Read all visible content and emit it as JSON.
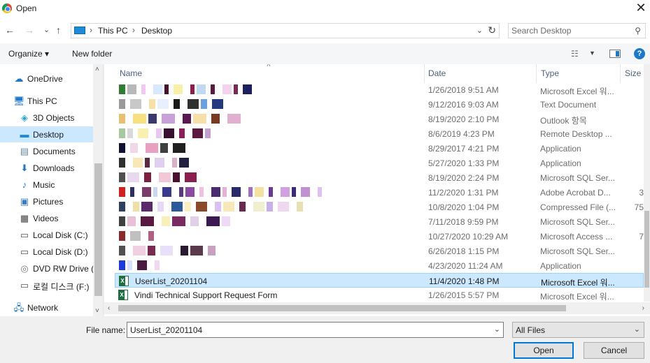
{
  "window": {
    "title": "Open",
    "close_glyph": "✕"
  },
  "nav": {
    "back": "←",
    "forward": "→",
    "recent": "⌄",
    "up": "↑"
  },
  "address": {
    "segments": [
      "This PC",
      "Desktop"
    ],
    "sep": "›",
    "dropdown": "⌄",
    "refresh": "↻"
  },
  "search": {
    "placeholder": "Search Desktop",
    "icon": "⚲"
  },
  "toolbar": {
    "organize": "Organize ▾",
    "new_folder": "New folder",
    "view_icon": "☷",
    "view_dd": "▼",
    "help": "?"
  },
  "sidebar": {
    "items": [
      {
        "label": "OneDrive",
        "icon": "☁",
        "color": "#1e78c8"
      },
      {
        "label": "This PC",
        "icon": "🖥",
        "color": "#1e78c8"
      },
      {
        "label": "3D Objects",
        "icon": "◈",
        "color": "#2aa3d8"
      },
      {
        "label": "Desktop",
        "icon": "▬",
        "color": "#1e8bd9",
        "selected": true
      },
      {
        "label": "Documents",
        "icon": "▤",
        "color": "#6a8aa8"
      },
      {
        "label": "Downloads",
        "icon": "⬇",
        "color": "#1e78c8"
      },
      {
        "label": "Music",
        "icon": "♪",
        "color": "#1e78c8"
      },
      {
        "label": "Pictures",
        "icon": "▣",
        "color": "#3a7bbf"
      },
      {
        "label": "Videos",
        "icon": "▦",
        "color": "#444"
      },
      {
        "label": "Local Disk (C:)",
        "icon": "▭",
        "color": "#555"
      },
      {
        "label": "Local Disk (D:)",
        "icon": "▭",
        "color": "#555"
      },
      {
        "label": "DVD RW Drive (E",
        "icon": "◎",
        "color": "#777"
      },
      {
        "label": "로컬 디스크 (F:)",
        "icon": "▭",
        "color": "#555"
      },
      {
        "label": "Network",
        "icon": "🖧",
        "color": "#1e78c8"
      }
    ],
    "scroll_up": "˄",
    "scroll_down": "˅"
  },
  "columns": {
    "name": "Name",
    "date": "Date",
    "type": "Type",
    "size": "Size",
    "sort_caret": "˄"
  },
  "files": [
    {
      "name": "",
      "date": "1/26/2018 9:51 AM",
      "type": "Microsoft Excel 워...",
      "size": "",
      "colors": [
        "#2e7d32",
        "#b8b8b8",
        "#f3c6f3",
        "#d8e8ff",
        "#4a1030",
        "#f7f1a8",
        "#8a1f4d",
        "#c0d8f0",
        "#5a1a40",
        "#f4d3f0",
        "#7a2a55",
        "#1f1f5f"
      ]
    },
    {
      "name": "",
      "date": "9/12/2016 9:03 AM",
      "type": "Text Document",
      "size": "",
      "colors": [
        "#9a9a9a",
        "#c8c8c8",
        "#f8e0a8",
        "#e6f0ff",
        "#1a1a1a",
        "#303030",
        "#6aa0e0",
        "#233a80"
      ]
    },
    {
      "name": "",
      "date": "8/19/2020 2:10 PM",
      "type": "Outlook 항목",
      "size": "",
      "colors": [
        "#e8c070",
        "#f8e080",
        "#3a3a6a",
        "#c9a0d8",
        "#5a1a50",
        "#f7e0a8",
        "#7a3a20",
        "#e0b0d0"
      ]
    },
    {
      "name": "",
      "date": "8/6/2019 4:23 PM",
      "type": "Remote Desktop ...",
      "size": "",
      "colors": [
        "#a8c8a0",
        "#d8d8d8",
        "#f8f0b0",
        "#e8c8f0",
        "#3a1030",
        "#8a1f5a",
        "#5a1a40",
        "#c0a0d0"
      ]
    },
    {
      "name": "",
      "date": "8/29/2017 4:21 PM",
      "type": "Application",
      "size": "",
      "colors": [
        "#101030",
        "#f0d8e8",
        "#e8a0c0",
        "#404040",
        "#202020"
      ]
    },
    {
      "name": "",
      "date": "5/27/2020 1:33 PM",
      "type": "Application",
      "size": "",
      "colors": [
        "#303030",
        "#f8e8b8",
        "#5a2a40",
        "#e0d0f0",
        "#d8b0c8",
        "#202040"
      ]
    },
    {
      "name": "",
      "date": "8/19/2020 2:24 PM",
      "type": "Microsoft SQL Ser...",
      "size": "",
      "colors": [
        "#505050",
        "#e8d8f0",
        "#7a2040",
        "#f0c8d8",
        "#4a1030",
        "#8a1f4d"
      ]
    },
    {
      "name": "",
      "date": "11/2/2020 1:31 PM",
      "type": "Adobe Acrobat D...",
      "size": "3",
      "colors": [
        "#d02020",
        "#303060",
        "#7a3a6a",
        "#c8d8f0",
        "#3a3a8a",
        "#5a3a7a",
        "#8a4aa0",
        "#f0c0e0",
        "#4a2a70",
        "#e8b0d8",
        "#2a2a6a",
        "#a070c0",
        "#f4e0a0",
        "#6a3a90",
        "#d0a0e0",
        "#3a2a80",
        "#c090d0",
        "#e0c0f0"
      ]
    },
    {
      "name": "",
      "date": "10/8/2020 1:04 PM",
      "type": "Compressed File (...",
      "size": "75",
      "colors": [
        "#304060",
        "#f0e0a8",
        "#5a2a6a",
        "#e8d8f8",
        "#2a5a9a",
        "#f8f0c0",
        "#8a4a2a",
        "#d8c0f0",
        "#f8e8b8",
        "#6a2a50",
        "#f0f0d0",
        "#c8b0e8",
        "#f0d8f0",
        "#e8e0b0"
      ]
    },
    {
      "name": "",
      "date": "7/11/2018 9:59 PM",
      "type": "Microsoft SQL Ser...",
      "size": "",
      "colors": [
        "#404040",
        "#e8c0d8",
        "#5a1a40",
        "#f8f0b8",
        "#7a2a60",
        "#e0d0e8",
        "#3a1a50",
        "#f0d8f8"
      ]
    },
    {
      "name": "",
      "date": "10/27/2020 10:29 AM",
      "type": "Microsoft Access ...",
      "size": "7",
      "colors": [
        "#8a2a2a",
        "#c0c0c0",
        "#b06080"
      ]
    },
    {
      "name": "",
      "date": "6/26/2018 1:15 PM",
      "type": "Microsoft SQL Ser...",
      "size": "",
      "colors": [
        "#505050",
        "#f0d0e0",
        "#7a2a50",
        "#e8e0f8",
        "#2a1a30",
        "#5a3a4a",
        "#c8a0c0"
      ]
    },
    {
      "name": "",
      "date": "4/23/2020 11:24 AM",
      "type": "Application",
      "size": "",
      "colors": [
        "#1a3adc",
        "#d8e0ff",
        "#4a1a40",
        "#f0d8f0"
      ]
    },
    {
      "name": "UserList_20201104",
      "date": "11/4/2020 1:48 PM",
      "type": "Microsoft Excel 워...",
      "size": "",
      "selected": true,
      "icon": "excel"
    },
    {
      "name": "Vindi Technical Support Request Form",
      "date": "1/26/2015 5:57 PM",
      "type": "Microsoft Excel 워...",
      "size": "",
      "icon": "excel"
    }
  ],
  "hscroll": {
    "left": "‹",
    "right": "›"
  },
  "bottom": {
    "filename_label": "File name:",
    "filename_value": "UserList_20201104",
    "filename_dd": "⌄",
    "filter_value": "All Files",
    "filter_dd": "⌄",
    "open_label": "Open",
    "cancel_label": "Cancel"
  }
}
